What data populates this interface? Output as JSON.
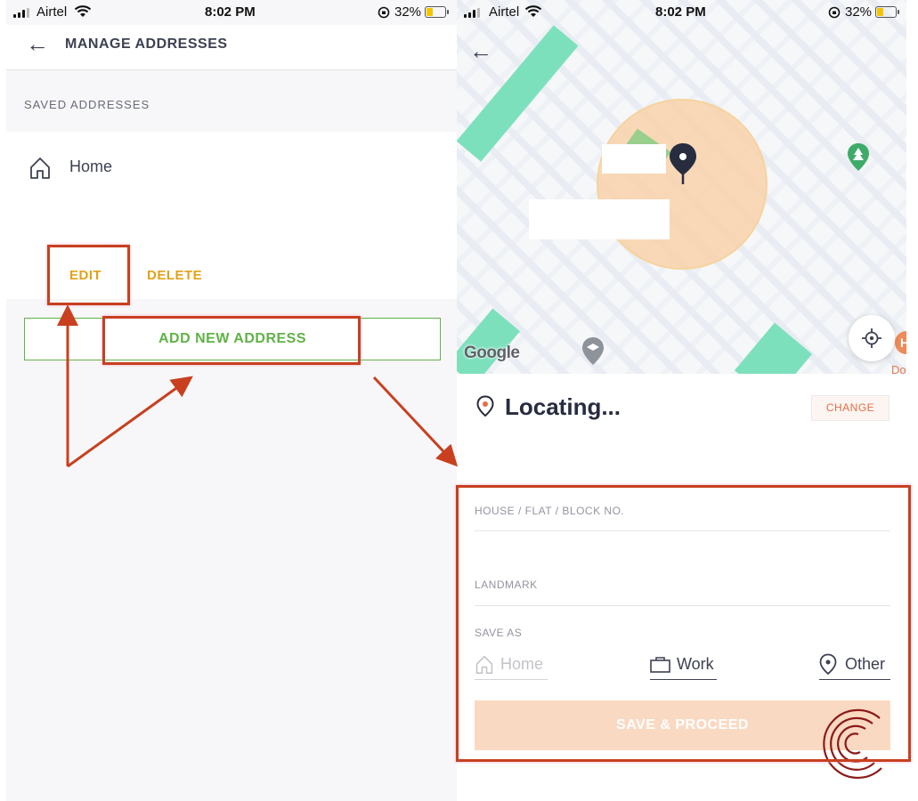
{
  "status_bar": {
    "carrier": "Airtel",
    "time": "8:02 PM",
    "battery": "32%"
  },
  "left_screen": {
    "header_title": "MANAGE ADDRESSES",
    "section_title": "SAVED ADDRESSES",
    "saved_address": {
      "label": "Home"
    },
    "edit_label": "EDIT",
    "delete_label": "DELETE",
    "add_new_label": "ADD NEW ADDRESS"
  },
  "right_screen": {
    "map_brand": "Google",
    "poi_partial": "H",
    "poi_partial_2": "Do",
    "location_title": "Locating...",
    "change_label": "CHANGE",
    "fields": {
      "house_label": "HOUSE / FLAT / BLOCK NO.",
      "landmark_label": "LANDMARK",
      "save_as_label": "SAVE AS"
    },
    "save_as_options": [
      "Home",
      "Work",
      "Other"
    ],
    "save_button_label": "SAVE & PROCEED"
  },
  "colors": {
    "accent_green": "#60b246",
    "accent_gold": "#e0a219",
    "accent_orange": "#e46d47",
    "annotation_red": "#c8401f"
  }
}
